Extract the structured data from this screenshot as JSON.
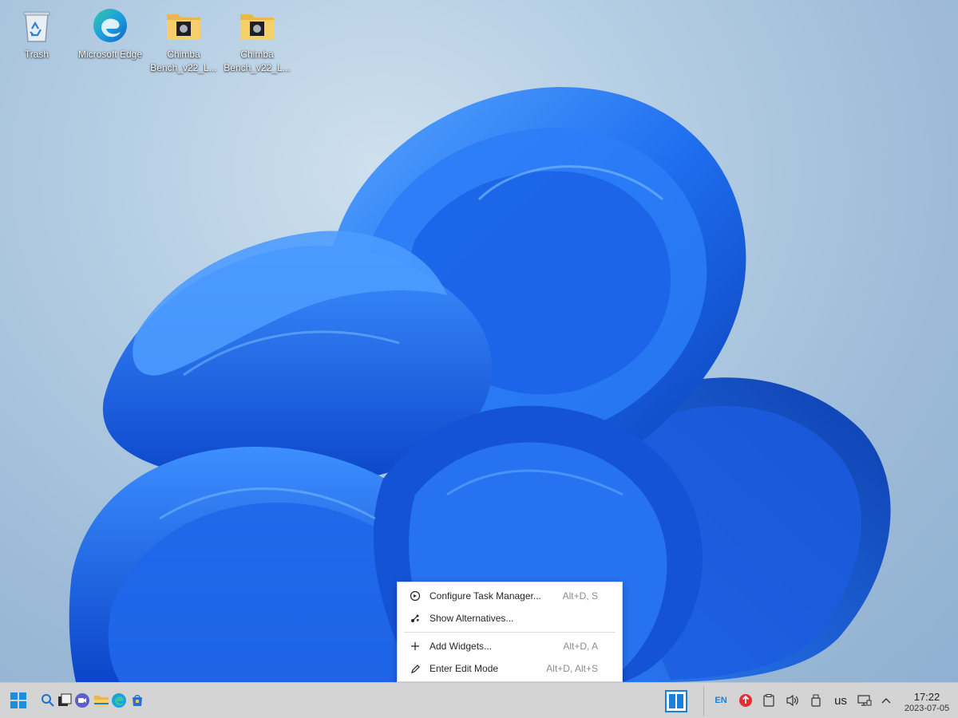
{
  "desktop": {
    "icons": [
      {
        "label": "Trash",
        "icon": "recycle-bin-icon"
      },
      {
        "label": "Microsoft Edge",
        "icon": "edge-icon"
      },
      {
        "label": "Chimba Bench_v22_L...",
        "icon": "folder-icon"
      },
      {
        "label": "Chimba Bench_v22_L...",
        "icon": "folder-icon"
      }
    ]
  },
  "context_menu": {
    "items": [
      {
        "label": "Configure Task Manager...",
        "shortcut": "Alt+D, S",
        "icon": "configure-icon"
      },
      {
        "label": "Show Alternatives...",
        "shortcut": "",
        "icon": "alternatives-icon"
      },
      {
        "label": "Add Widgets...",
        "shortcut": "Alt+D, A",
        "icon": "plus-icon"
      },
      {
        "label": "Enter Edit Mode",
        "shortcut": "Alt+D, Alt+S",
        "icon": "pencil-icon"
      }
    ]
  },
  "taskbar": {
    "apps": [
      "start-menu-icon",
      "search-icon",
      "task-view-icon",
      "video-call-icon",
      "file-explorer-icon",
      "edge-icon",
      "store-icon"
    ],
    "tray": {
      "language": "EN",
      "keyboard_layout": "us",
      "time": "17:22",
      "date": "2023-07-05"
    }
  },
  "colors": {
    "accent": "#1e7bd8",
    "taskbar_bg": "#d4d4d4",
    "menu_bg": "#ffffff",
    "update_badge": "#e03030"
  }
}
